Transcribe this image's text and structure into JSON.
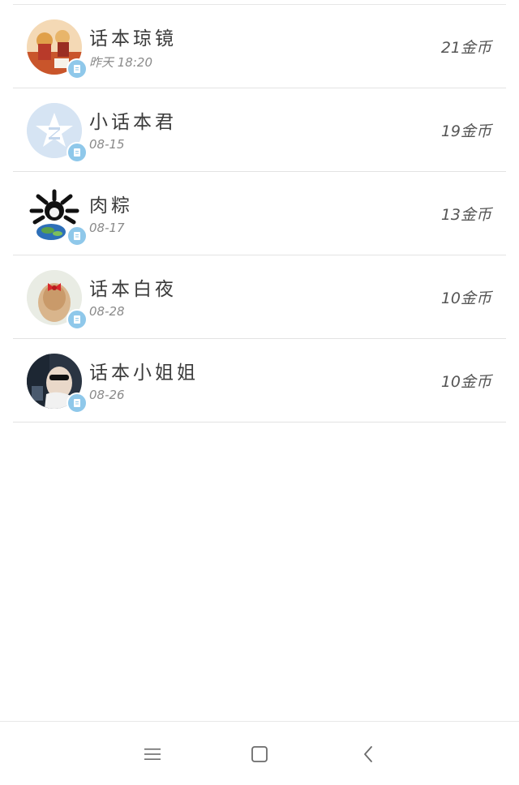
{
  "rows": [
    {
      "name": "话本琼镜",
      "date": "昨天 18:20",
      "coins": "21金币",
      "avatar_icon": "cartoon-avatar"
    },
    {
      "name": "小话本君",
      "date": "08-15",
      "coins": "19金币",
      "avatar_icon": "default-qq-avatar"
    },
    {
      "name": "肉粽",
      "date": "08-17",
      "coins": "13金币",
      "avatar_icon": "skull-earth-avatar"
    },
    {
      "name": "话本白夜",
      "date": "08-28",
      "coins": "10金币",
      "avatar_icon": "girl-red-bow-avatar"
    },
    {
      "name": "话本小姐姐",
      "date": "08-26",
      "coins": "10金币",
      "avatar_icon": "sunglasses-avatar"
    }
  ],
  "badge_icon": "document-badge-icon",
  "nav": {
    "menu_icon": "menu-icon",
    "home_icon": "home-square-icon",
    "back_icon": "back-chevron-icon"
  },
  "colors": {
    "badge": "#8fc8ea",
    "divider": "#e3e3e3"
  }
}
